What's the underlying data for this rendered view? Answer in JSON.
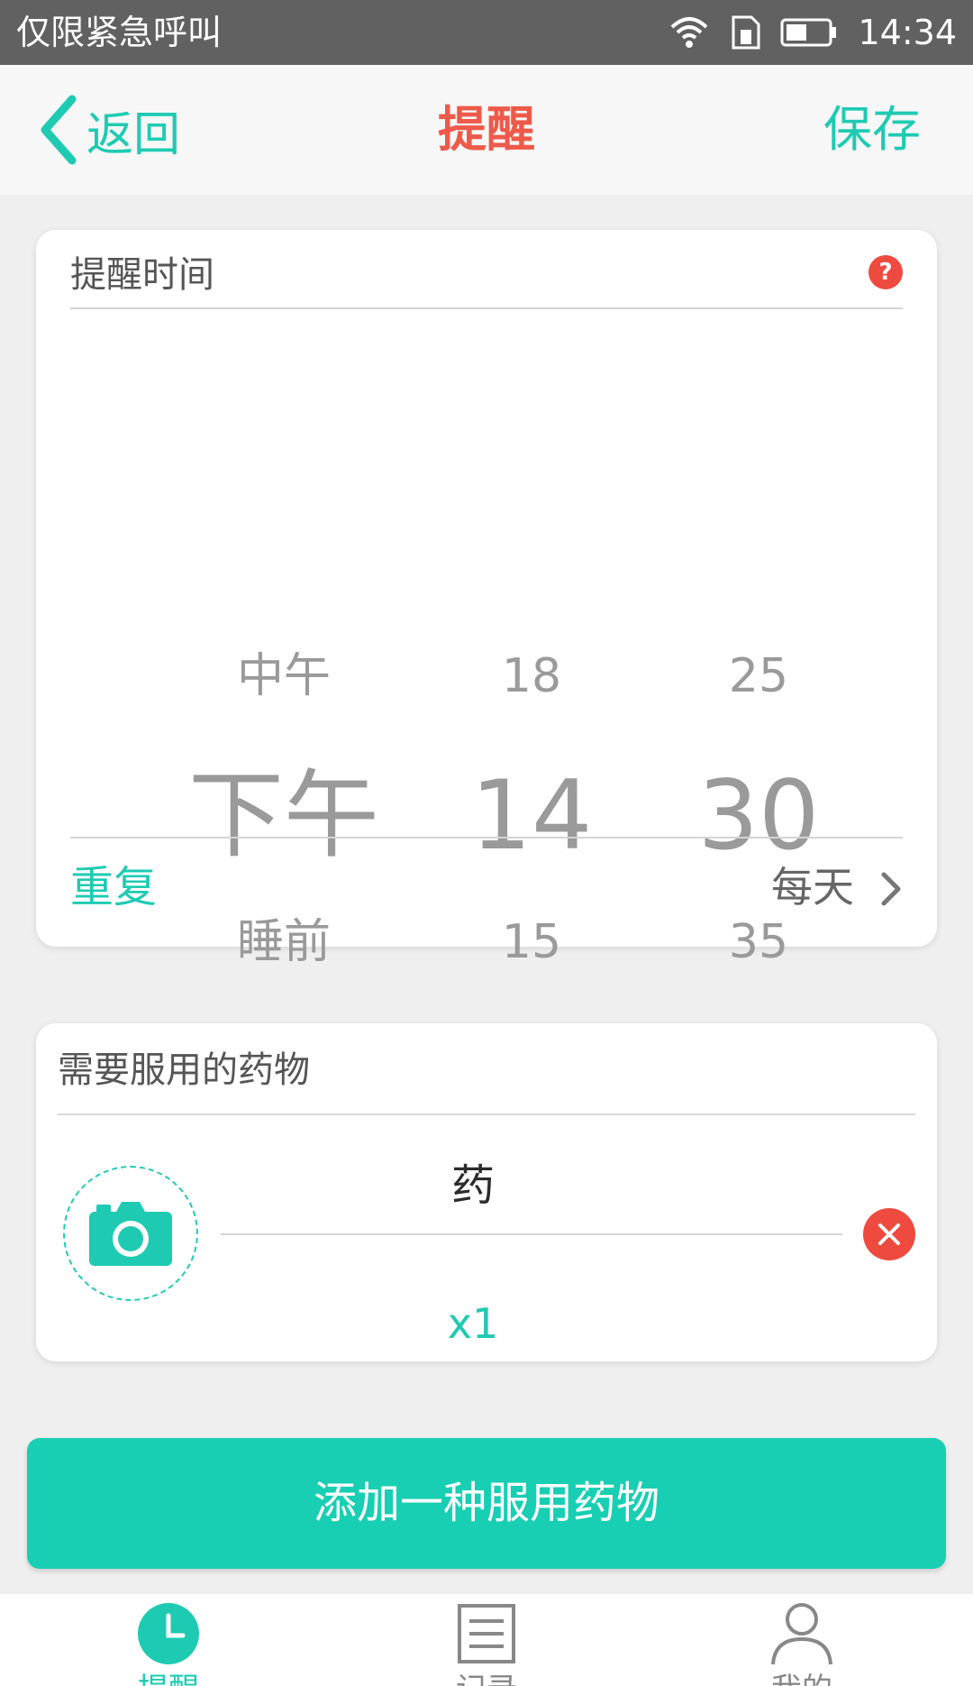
{
  "status_bar": {
    "carrier": "仅限紧急呼叫",
    "time": "14:34"
  },
  "nav": {
    "back_label": "返回",
    "title": "提醒",
    "save_label": "保存"
  },
  "reminder_time": {
    "title": "提醒时间",
    "picker": {
      "period": {
        "prev": "中午",
        "current": "下午",
        "next": "睡前"
      },
      "hour": {
        "prev": "18",
        "current": "14",
        "next": "15"
      },
      "minute": {
        "prev": "25",
        "current": "30",
        "next": "35"
      }
    },
    "repeat_label": "重复",
    "repeat_value": "每天"
  },
  "medicines": {
    "title": "需要服用的药物",
    "items": [
      {
        "name": "药",
        "quantity": "x1"
      }
    ]
  },
  "add_medicine_label": "添加一种服用药物",
  "tabs": [
    {
      "label": "提醒",
      "active": true
    },
    {
      "label": "记录",
      "active": false
    },
    {
      "label": "我的",
      "active": false
    }
  ],
  "colors": {
    "accent": "#1ecbb2",
    "title_red": "#ee5a4a",
    "danger": "#ee4a3f"
  }
}
